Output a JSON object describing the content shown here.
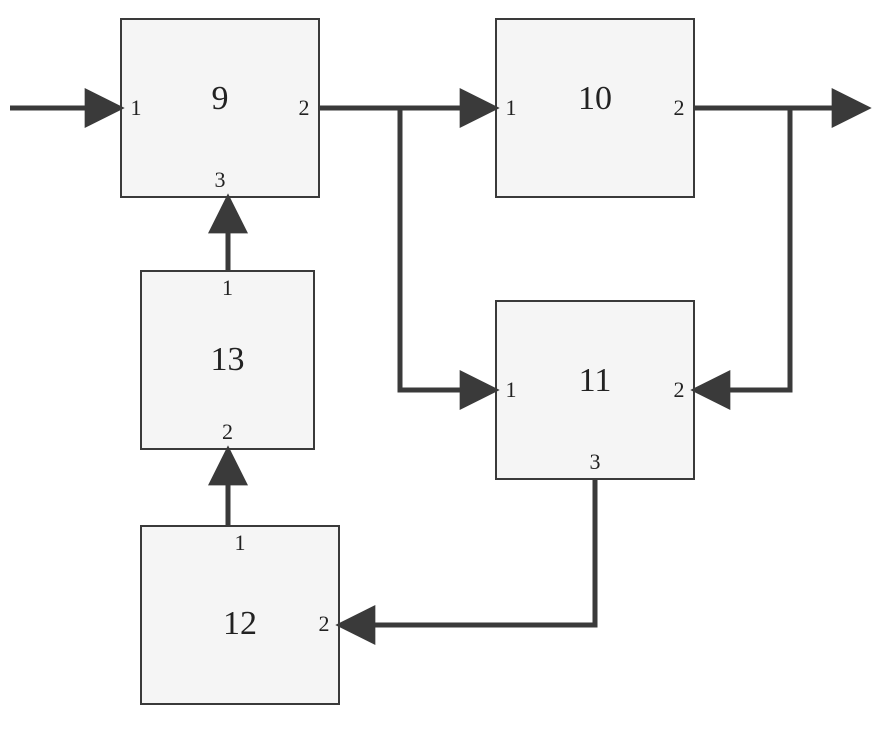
{
  "diagram": {
    "blocks": {
      "b9": {
        "label": "9",
        "ports": {
          "p1": "1",
          "p2": "2",
          "p3": "3"
        }
      },
      "b10": {
        "label": "10",
        "ports": {
          "p1": "1",
          "p2": "2"
        }
      },
      "b11": {
        "label": "11",
        "ports": {
          "p1": "1",
          "p2": "2",
          "p3": "3"
        }
      },
      "b12": {
        "label": "12",
        "ports": {
          "p1": "1",
          "p2": "2"
        }
      },
      "b13": {
        "label": "13",
        "ports": {
          "p1": "1",
          "p2": "2"
        }
      }
    },
    "edges": [
      {
        "from": "input",
        "to": "b9.p1"
      },
      {
        "from": "b9.p2",
        "to": "b10.p1"
      },
      {
        "from": "b10.p2",
        "to": "output"
      },
      {
        "from": "b9.p2",
        "to": "b11.p1"
      },
      {
        "from": "b10.p2",
        "to": "b11.p2"
      },
      {
        "from": "b11.p3",
        "to": "b12.p2"
      },
      {
        "from": "b12.p1",
        "to": "b13.p2"
      },
      {
        "from": "b13.p1",
        "to": "b9.p3"
      }
    ]
  }
}
